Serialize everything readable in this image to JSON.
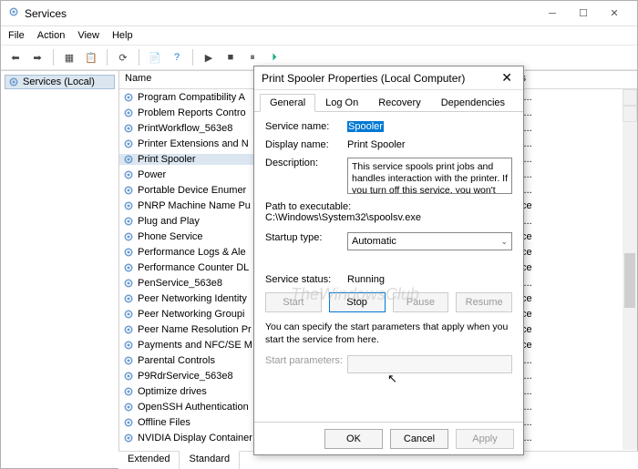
{
  "window": {
    "title": "Services",
    "menus": [
      "File",
      "Action",
      "View",
      "Help"
    ]
  },
  "tree": {
    "root": "Services (Local)"
  },
  "columns": {
    "name": "Name",
    "logonAs": "On As"
  },
  "footerTabs": {
    "extended": "Extended",
    "standard": "Standard"
  },
  "rows": [
    {
      "name": "Program Compatibility A",
      "logon": "Syste..."
    },
    {
      "name": "Problem Reports Contro",
      "logon": "Syste..."
    },
    {
      "name": "PrintWorkflow_563e8",
      "logon": "Syste..."
    },
    {
      "name": "Printer Extensions and N",
      "logon": "Syste..."
    },
    {
      "name": "Print Spooler",
      "logon": "Syste...",
      "selected": true
    },
    {
      "name": "Power",
      "logon": "Syste..."
    },
    {
      "name": "Portable Device Enumer",
      "logon": "Syste..."
    },
    {
      "name": "PNRP Machine Name Pu",
      "logon": "Service"
    },
    {
      "name": "Plug and Play",
      "logon": "Syste..."
    },
    {
      "name": "Phone Service",
      "logon": "Service"
    },
    {
      "name": "Performance Logs & Ale",
      "logon": "Service"
    },
    {
      "name": "Performance Counter DL",
      "logon": "Service"
    },
    {
      "name": "PenService_563e8",
      "logon": "Syste..."
    },
    {
      "name": "Peer Networking Identity",
      "logon": "Service"
    },
    {
      "name": "Peer Networking Groupi",
      "logon": "Service"
    },
    {
      "name": "Peer Name Resolution Pr",
      "logon": "Service"
    },
    {
      "name": "Payments and NFC/SE M",
      "logon": "Service"
    },
    {
      "name": "Parental Controls",
      "logon": "Syste..."
    },
    {
      "name": "P9RdrService_563e8",
      "logon": "Syste..."
    },
    {
      "name": "Optimize drives",
      "logon": "Syste..."
    },
    {
      "name": "OpenSSH Authentication",
      "logon": "Syste..."
    },
    {
      "name": "Offline Files",
      "logon": "Syste..."
    },
    {
      "name": "NVIDIA Display Container",
      "logon": "Syste..."
    }
  ],
  "dialog": {
    "title": "Print Spooler Properties (Local Computer)",
    "tabs": {
      "general": "General",
      "logon": "Log On",
      "recovery": "Recovery",
      "dependencies": "Dependencies"
    },
    "labels": {
      "serviceName": "Service name:",
      "displayName": "Display name:",
      "description": "Description:",
      "pathHeader": "Path to executable:",
      "startupType": "Startup type:",
      "serviceStatus": "Service status:",
      "startParams": "Start parameters:"
    },
    "values": {
      "serviceName": "Spooler",
      "displayName": "Print Spooler",
      "description": "This service spools print jobs and handles interaction with the printer.  If you turn off this service, you won't be able to print or see your printers",
      "path": "C:\\Windows\\System32\\spoolsv.exe",
      "startupType": "Automatic",
      "serviceStatus": "Running"
    },
    "buttons": {
      "start": "Start",
      "stop": "Stop",
      "pause": "Pause",
      "resume": "Resume"
    },
    "note": "You can specify the start parameters that apply when you start the service from here.",
    "footer": {
      "ok": "OK",
      "cancel": "Cancel",
      "apply": "Apply"
    }
  },
  "watermark": "TheWindowsClub"
}
